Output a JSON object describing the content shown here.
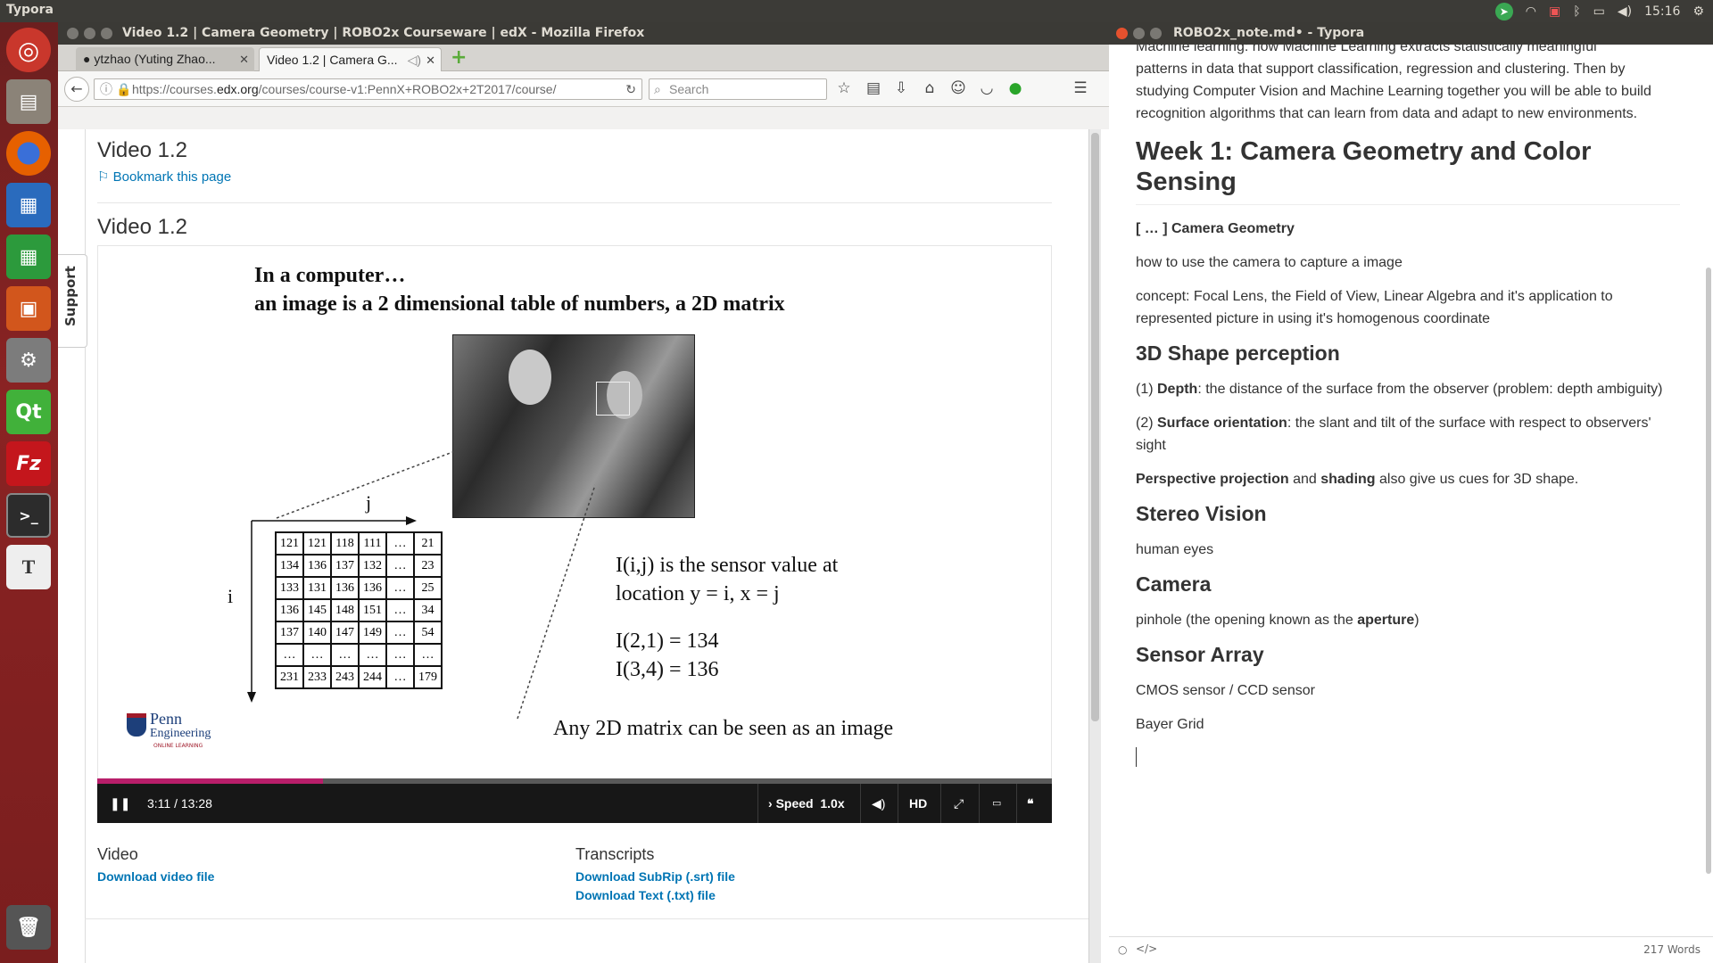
{
  "panel": {
    "app_name": "Typora",
    "clock": "15:16"
  },
  "firefox": {
    "window_title": "Video 1.2 | Camera Geometry | ROBO2x Courseware | edX - Mozilla Firefox",
    "tabs": [
      {
        "label": "ytzhao (Yuting Zhao..."
      },
      {
        "label": "Video 1.2 | Camera G..."
      }
    ],
    "url_prefix": "https://courses.",
    "url_domain": "edx.org",
    "url_rest": "/courses/course-v1:PennX+ROBO2x+2T2017/course/",
    "search_placeholder": "Search"
  },
  "page": {
    "support_label": "Support",
    "heading": "Video 1.2",
    "bookmark": "Bookmark this page",
    "video_heading": "Video 1.2",
    "slide": {
      "line1": "In a computer…",
      "line2": "an image is a 2 dimensional table of numbers, a 2D matrix",
      "axis_j": "j",
      "axis_i": "i",
      "matrix": [
        [
          "121",
          "121",
          "118",
          "111",
          "…",
          "21"
        ],
        [
          "134",
          "136",
          "137",
          "132",
          "…",
          "23"
        ],
        [
          "133",
          "131",
          "136",
          "136",
          "…",
          "25"
        ],
        [
          "136",
          "145",
          "148",
          "151",
          "…",
          "34"
        ],
        [
          "137",
          "140",
          "147",
          "149",
          "…",
          "54"
        ],
        [
          "…",
          "…",
          "…",
          "…",
          "…",
          "…"
        ],
        [
          "231",
          "233",
          "243",
          "244",
          "…",
          "179"
        ]
      ],
      "def_line1": "I(i,j) is the sensor value at",
      "def_line2": "location y = i, x = j",
      "ex1": "I(2,1) = 134",
      "ex2": "I(3,4) = 136",
      "footer": "Any 2D matrix can be seen as an image",
      "logo_line1": "Penn",
      "logo_line2": "Engineering",
      "logo_line3": "ONLINE LEARNING"
    },
    "player": {
      "progress_fraction": 0.236,
      "time": "3:11 / 13:28",
      "speed_label": "Speed",
      "speed_value": "1.0x",
      "hd_label": "HD"
    },
    "downloads": {
      "video_heading": "Video",
      "video_link": "Download video file",
      "transcripts_heading": "Transcripts",
      "srt_link": "Download SubRip (.srt) file",
      "txt_link": "Download Text (.txt) file"
    }
  },
  "typora": {
    "window_title": "ROBO2x_note.md• - Typora",
    "intro_cut": "Machine learning: how Machine Learning extracts statistically meaningful",
    "intro": "patterns in data that support classification, regression and clustering. Then by studying Computer Vision and Machine Learning together you will be able to build recognition algorithms that can learn from data and adapt to new environments.",
    "h1": "Week 1: Camera Geometry and Color Sensing",
    "camgeo_title": "[ … ] Camera Geometry",
    "camgeo_p1": "how to use the camera to capture a image",
    "camgeo_p2": "concept: Focal Lens, the Field of View, Linear Algebra and it's application to represented picture in using it's homogenous coordinate",
    "h2_shape": "3D Shape perception",
    "depth_prefix": "(1) ",
    "depth_bold": "Depth",
    "depth_rest": ": the distance of the surface from the observer (problem: depth ambiguity)",
    "orient_prefix": "(2) ",
    "orient_bold": "Surface orientation",
    "orient_rest": ": the slant and tilt of the surface with respect to observers' sight",
    "persp_bold": "Perspective projection",
    "persp_and": " and ",
    "shading_bold": "shading",
    "persp_rest": " also give us cues for 3D shape.",
    "h2_stereo": "Stereo Vision",
    "stereo_p": "human eyes",
    "h2_camera": "Camera",
    "camera_prefix": "pinhole (the opening known as the ",
    "camera_bold": "aperture",
    "camera_suffix": ")",
    "h2_sensor": "Sensor Array",
    "sensor_p1": "CMOS sensor / CCD sensor",
    "sensor_p2": "Bayer Grid",
    "word_count": "217 Words"
  }
}
